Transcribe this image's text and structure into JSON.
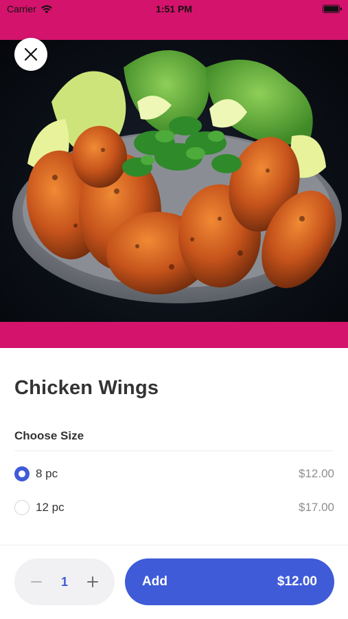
{
  "status_bar": {
    "carrier": "Carrier",
    "time": "1:51 PM",
    "wifi_icon": "wifi-icon",
    "battery_icon": "battery-icon"
  },
  "hero": {
    "image_subject": "plate of glazed chicken wings with lettuce, lime wedges and cilantro",
    "close_icon": "close-icon"
  },
  "product": {
    "title": "Chicken Wings"
  },
  "size_section": {
    "label": "Choose Size",
    "options": [
      {
        "label": "8 pc",
        "price": "$12.00",
        "selected": true
      },
      {
        "label": "12 pc",
        "price": "$17.00",
        "selected": false
      }
    ]
  },
  "footer": {
    "quantity": "1",
    "minus_icon": "minus-icon",
    "plus_icon": "plus-icon",
    "add_label": "Add",
    "add_price": "$12.00"
  },
  "colors": {
    "brand_pink": "#d4136c",
    "accent_blue": "#3f5bd7"
  }
}
